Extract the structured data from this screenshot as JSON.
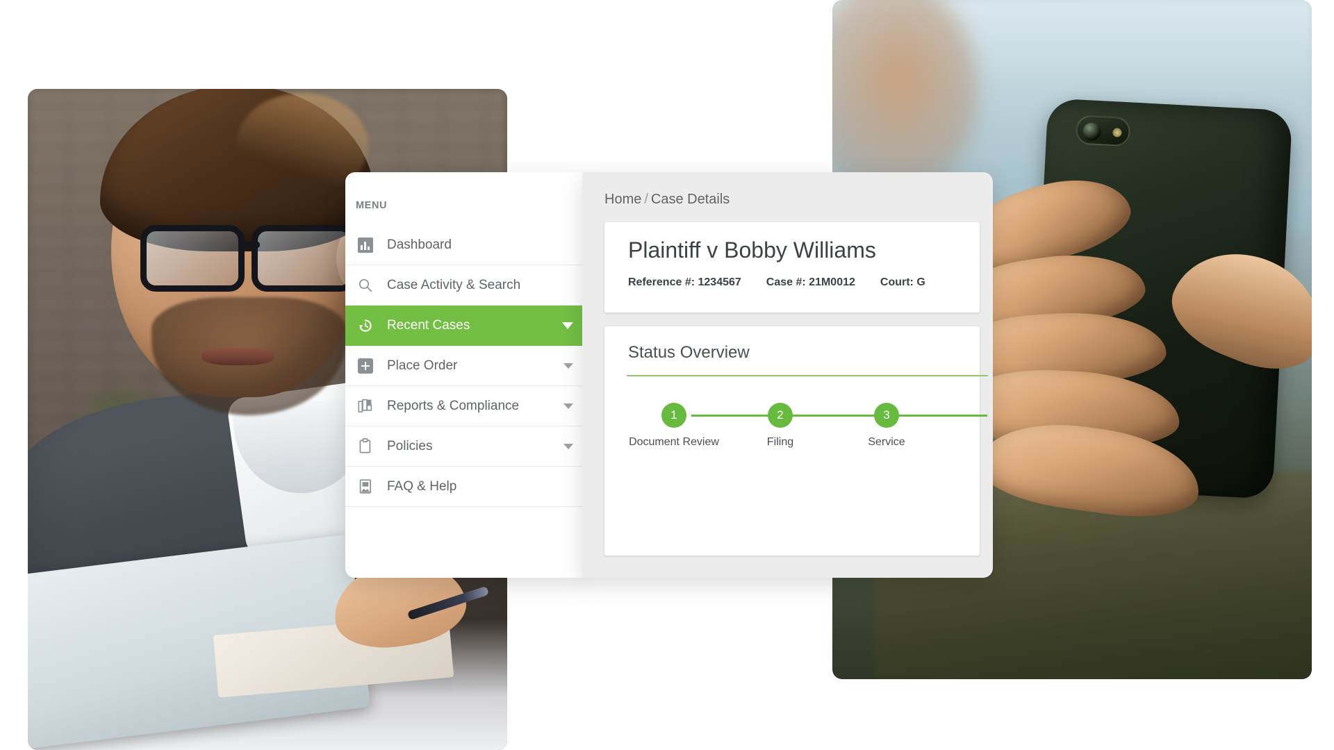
{
  "theme": {
    "accent_green": "#72bf44",
    "step_green": "#66bb3e",
    "rule_green": "#8cc96a",
    "panel_bg": "#ececec",
    "card_bg": "#ffffff",
    "text_primary": "#3c4145",
    "text_secondary": "#5f6468",
    "menu_label": "#7a7f83"
  },
  "sidebar": {
    "title": "MENU",
    "items": [
      {
        "label": "Dashboard",
        "icon": "bar-chart-icon",
        "has_caret": false,
        "active": false
      },
      {
        "label": "Case Activity & Search",
        "icon": "search-icon",
        "has_caret": false,
        "active": false
      },
      {
        "label": "Recent Cases",
        "icon": "history-icon",
        "has_caret": true,
        "active": true
      },
      {
        "label": "Place Order",
        "icon": "plus-square-icon",
        "has_caret": true,
        "active": false
      },
      {
        "label": "Reports & Compliance",
        "icon": "books-icon",
        "has_caret": true,
        "active": false
      },
      {
        "label": "Policies",
        "icon": "clipboard-icon",
        "has_caret": true,
        "active": false
      },
      {
        "label": "FAQ & Help",
        "icon": "help-book-icon",
        "has_caret": false,
        "active": false
      }
    ]
  },
  "breadcrumb": {
    "home": "Home",
    "separator": "/",
    "current": "Case Details"
  },
  "case": {
    "title": "Plaintiff v Bobby Williams",
    "meta": [
      {
        "label": "Reference #:",
        "value": "1234567"
      },
      {
        "label": "Case #:",
        "value": "21M0012"
      },
      {
        "label": "Court:",
        "value": "G"
      }
    ]
  },
  "status": {
    "heading": "Status Overview",
    "steps": [
      {
        "number": "1",
        "label": "Document Review"
      },
      {
        "number": "2",
        "label": "Filing"
      },
      {
        "number": "3",
        "label": "Service"
      }
    ]
  },
  "photos": {
    "left": {
      "alt": "man-with-glasses-at-laptop-photo"
    },
    "right": {
      "alt": "hands-holding-smartphone-photo"
    }
  }
}
